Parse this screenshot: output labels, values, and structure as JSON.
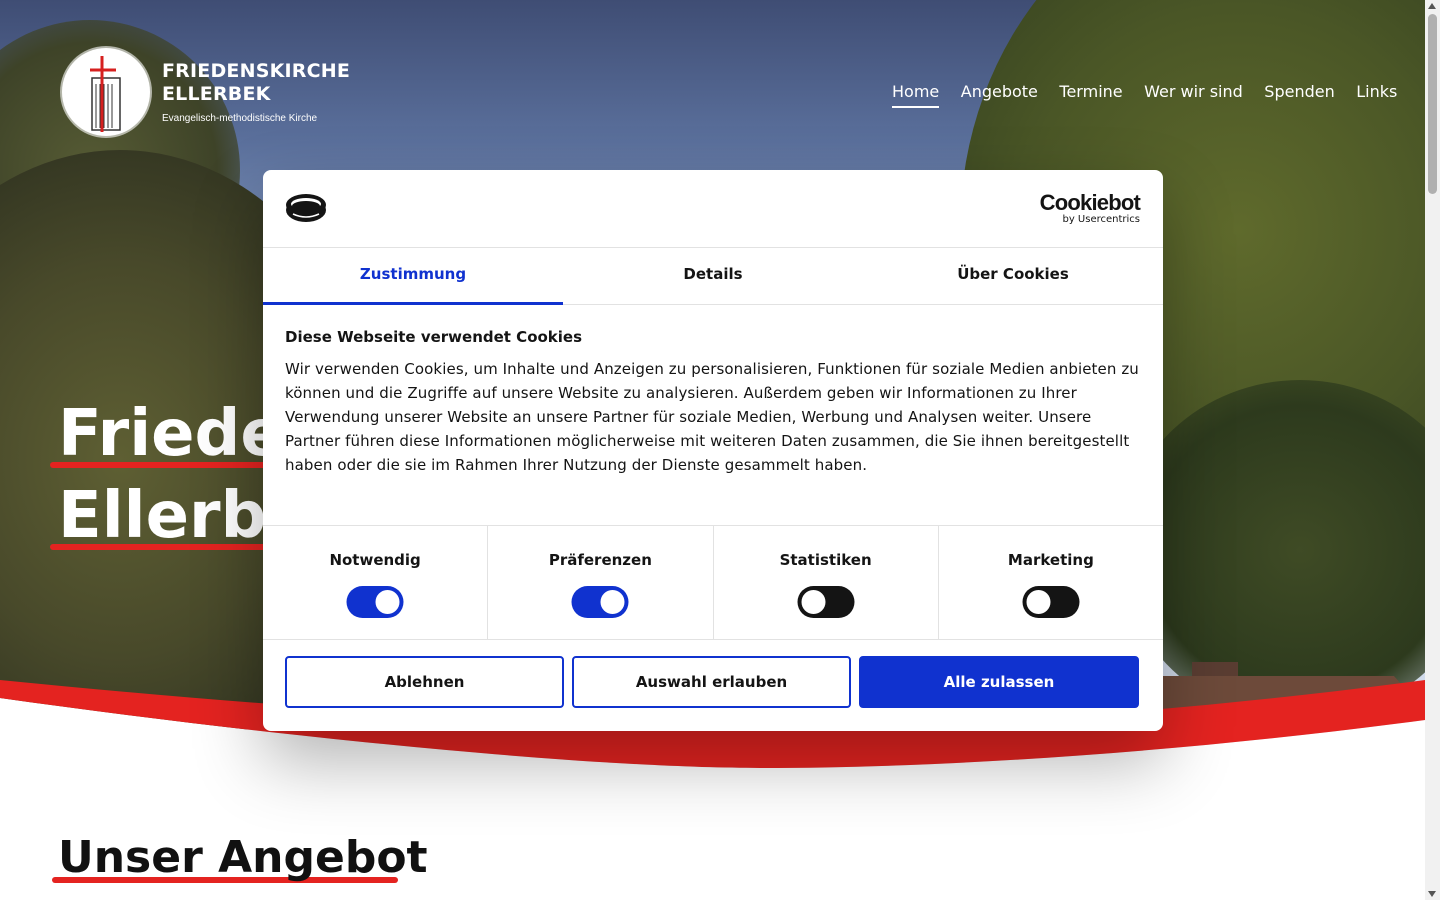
{
  "site": {
    "logo_title_1": "FRIEDENSKIRCHE",
    "logo_title_2": "ELLERBEK",
    "logo_subtitle": "Evangelisch-methodistische Kirche"
  },
  "nav": {
    "items": [
      {
        "label": "Home",
        "active": true
      },
      {
        "label": "Angebote",
        "active": false
      },
      {
        "label": "Termine",
        "active": false
      },
      {
        "label": "Wer wir sind",
        "active": false
      },
      {
        "label": "Spenden",
        "active": false
      },
      {
        "label": "Links",
        "active": false
      }
    ]
  },
  "hero": {
    "headline_line1": "Friede",
    "headline_line2": "Ellerbe"
  },
  "section": {
    "title": "Unser Angebot"
  },
  "cookie_dialog": {
    "brand_name": "Cookiebot",
    "brand_sub": "by Usercentrics",
    "tabs": [
      {
        "label": "Zustimmung",
        "active": true
      },
      {
        "label": "Details",
        "active": false
      },
      {
        "label": "Über Cookies",
        "active": false
      }
    ],
    "heading": "Diese Webseite verwendet Cookies",
    "text": "Wir verwenden Cookies, um Inhalte und Anzeigen zu personalisieren, Funktionen für soziale Medien anbieten zu können und die Zugriffe auf unsere Website zu analysieren. Außerdem geben wir Informationen zu Ihrer Verwendung unserer Website an unsere Partner für soziale Medien, Werbung und Analysen weiter. Unsere Partner führen diese Informationen möglicherweise mit weiteren Daten zusammen, die Sie ihnen bereitgestellt haben oder die sie im Rahmen Ihrer Nutzung der Dienste gesammelt haben.",
    "categories": [
      {
        "label": "Notwendig",
        "enabled": true
      },
      {
        "label": "Präferenzen",
        "enabled": true
      },
      {
        "label": "Statistiken",
        "enabled": false
      },
      {
        "label": "Marketing",
        "enabled": false
      }
    ],
    "buttons": {
      "reject": "Ablehnen",
      "allow_selection": "Auswahl erlauben",
      "allow_all": "Alle zulassen"
    }
  },
  "colors": {
    "accent_blue": "#1032cf",
    "brand_red": "#e42320"
  },
  "icons": [
    "cookiebot-logo-icon",
    "church-logo-icon"
  ]
}
